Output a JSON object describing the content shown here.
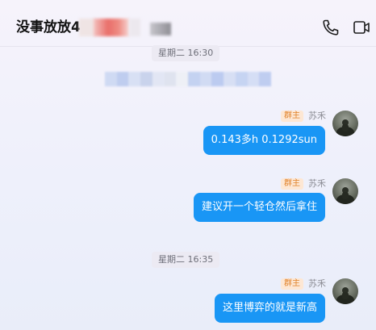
{
  "header": {
    "title": "没事放放4",
    "icons": [
      "phone-icon",
      "video-icon"
    ]
  },
  "colors": {
    "bubble": "#1996f5",
    "badge_text": "#e0822a",
    "badge_bg": "#fde7d4"
  },
  "messages": [
    {
      "timestamp": "星期二 16:30"
    },
    {
      "badge": "群主",
      "sender": "苏禾",
      "text": "0.143多h 0.1292sun"
    },
    {
      "badge": "群主",
      "sender": "苏禾",
      "text": "建议开一个轻仓然后拿住"
    },
    {
      "timestamp": "星期二 16:35"
    },
    {
      "badge": "群主",
      "sender": "苏禾",
      "text": "这里博弈的就是新高"
    }
  ]
}
